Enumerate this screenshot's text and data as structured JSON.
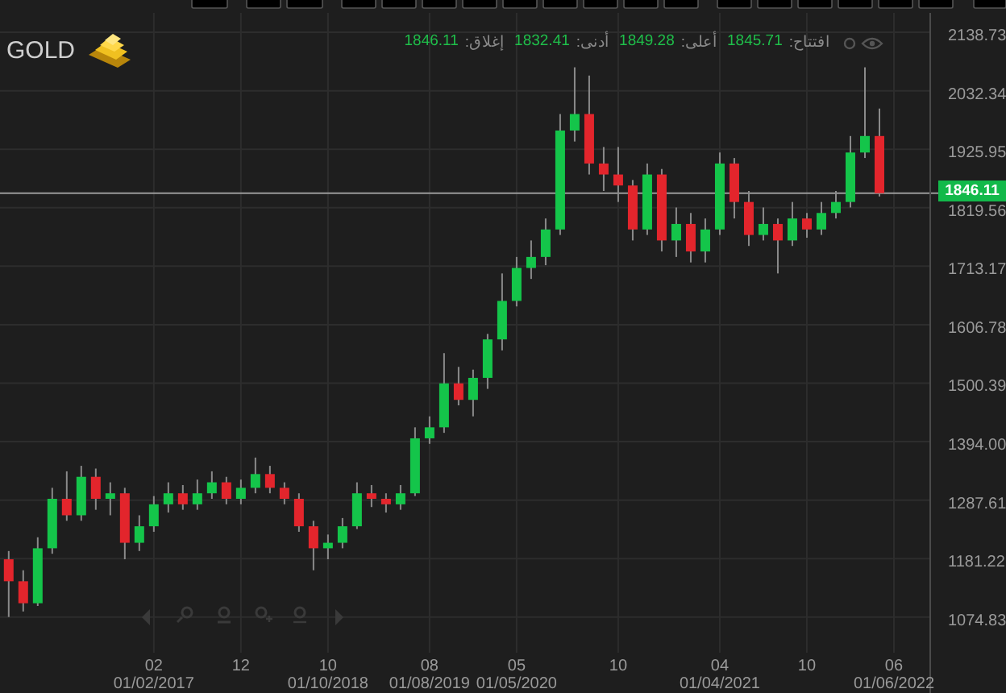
{
  "symbol": {
    "name": "GOLD"
  },
  "ohlc_header": [
    {
      "kind": "value",
      "text": "1846.11"
    },
    {
      "kind": "label",
      "text": "إغلاق:"
    },
    {
      "kind": "value",
      "text": "1832.41"
    },
    {
      "kind": "label",
      "text": "أدنى:"
    },
    {
      "kind": "value",
      "text": "1849.28"
    },
    {
      "kind": "label",
      "text": "أعلى:"
    },
    {
      "kind": "value",
      "text": "1845.71"
    },
    {
      "kind": "label",
      "text": "افتتاح:"
    }
  ],
  "chart": {
    "x_dates": [
      {
        "kind": "dated",
        "date": "01/02/2017"
      },
      {
        "kind": "plain"
      },
      {
        "kind": "dated",
        "date": "01/10/2018"
      },
      {
        "kind": "dated",
        "date": "01/08/2019"
      },
      {
        "kind": "dated",
        "date": "01/05/2020"
      },
      {
        "kind": "plain"
      },
      {
        "kind": "dated",
        "date": "01/04/2021"
      },
      {
        "kind": "plain"
      },
      {
        "kind": "dated",
        "date": "01/06/2022"
      }
    ],
    "chart_data": {
      "type": "candlestick",
      "ylim": [
        1010,
        2174
      ],
      "grid": true,
      "ref_lines": [
        {
          "axis": "y",
          "value": 1846.11,
          "label": "1846.11",
          "color": "#9a9a9a"
        }
      ],
      "categories": [
        null,
        null,
        null,
        null,
        null,
        null,
        null,
        null,
        null,
        null,
        "02",
        null,
        null,
        null,
        null,
        null,
        "12",
        null,
        null,
        null,
        null,
        null,
        "10",
        null,
        null,
        null,
        null,
        null,
        null,
        "08",
        null,
        null,
        null,
        null,
        null,
        "05",
        null,
        null,
        null,
        null,
        null,
        null,
        "10",
        null,
        null,
        null,
        null,
        null,
        null,
        "04",
        null,
        null,
        null,
        null,
        null,
        "10",
        null,
        null,
        null,
        null,
        null,
        "06"
      ],
      "yticks": [
        {
          "value": 1074.83,
          "label": "1074.83"
        },
        {
          "value": 1181.22,
          "label": "1181.22"
        },
        {
          "value": 1287.61,
          "label": "1287.61"
        },
        {
          "value": 1394.0,
          "label": "1394.00"
        },
        {
          "value": 1500.39,
          "label": "1500.39"
        },
        {
          "value": 1606.78,
          "label": "1606.78"
        },
        {
          "value": 1713.17,
          "label": "1713.17"
        },
        {
          "value": 1819.56,
          "label": "1819.56"
        },
        {
          "value": 1925.95,
          "label": "1925.95"
        },
        {
          "value": 2032.34,
          "label": "2032.34"
        },
        {
          "value": 2138.73,
          "label": "2138.73"
        }
      ],
      "ohlc": [
        [
          1180,
          1195,
          1075,
          1140
        ],
        [
          1140,
          1160,
          1085,
          1100
        ],
        [
          1100,
          1220,
          1095,
          1200
        ],
        [
          1200,
          1310,
          1190,
          1290
        ],
        [
          1290,
          1340,
          1250,
          1260
        ],
        [
          1260,
          1350,
          1250,
          1330
        ],
        [
          1330,
          1345,
          1270,
          1290
        ],
        [
          1290,
          1320,
          1260,
          1300
        ],
        [
          1300,
          1310,
          1180,
          1210
        ],
        [
          1210,
          1260,
          1195,
          1240
        ],
        [
          1240,
          1295,
          1230,
          1280
        ],
        [
          1280,
          1320,
          1265,
          1300
        ],
        [
          1300,
          1315,
          1270,
          1280
        ],
        [
          1280,
          1325,
          1270,
          1300
        ],
        [
          1300,
          1340,
          1290,
          1320
        ],
        [
          1320,
          1330,
          1280,
          1290
        ],
        [
          1290,
          1325,
          1280,
          1310
        ],
        [
          1310,
          1365,
          1300,
          1335
        ],
        [
          1335,
          1350,
          1300,
          1310
        ],
        [
          1310,
          1320,
          1280,
          1290
        ],
        [
          1290,
          1300,
          1230,
          1240
        ],
        [
          1240,
          1250,
          1160,
          1200
        ],
        [
          1200,
          1225,
          1180,
          1210
        ],
        [
          1210,
          1255,
          1200,
          1240
        ],
        [
          1240,
          1320,
          1235,
          1300
        ],
        [
          1300,
          1315,
          1275,
          1290
        ],
        [
          1290,
          1300,
          1265,
          1280
        ],
        [
          1280,
          1315,
          1270,
          1300
        ],
        [
          1300,
          1420,
          1295,
          1400
        ],
        [
          1400,
          1440,
          1390,
          1420
        ],
        [
          1420,
          1555,
          1410,
          1500
        ],
        [
          1500,
          1530,
          1460,
          1470
        ],
        [
          1470,
          1525,
          1440,
          1510
        ],
        [
          1510,
          1590,
          1490,
          1580
        ],
        [
          1580,
          1700,
          1560,
          1650
        ],
        [
          1650,
          1730,
          1640,
          1710
        ],
        [
          1710,
          1760,
          1690,
          1730
        ],
        [
          1730,
          1800,
          1715,
          1780
        ],
        [
          1780,
          1990,
          1770,
          1960
        ],
        [
          1960,
          2075,
          1940,
          1990
        ],
        [
          1990,
          2060,
          1880,
          1900
        ],
        [
          1900,
          1930,
          1850,
          1880
        ],
        [
          1880,
          1930,
          1830,
          1860
        ],
        [
          1860,
          1870,
          1760,
          1780
        ],
        [
          1780,
          1900,
          1770,
          1880
        ],
        [
          1880,
          1890,
          1740,
          1760
        ],
        [
          1760,
          1820,
          1730,
          1790
        ],
        [
          1790,
          1810,
          1720,
          1740
        ],
        [
          1740,
          1800,
          1720,
          1780
        ],
        [
          1780,
          1920,
          1770,
          1900
        ],
        [
          1900,
          1910,
          1800,
          1830
        ],
        [
          1830,
          1850,
          1750,
          1770
        ],
        [
          1770,
          1820,
          1760,
          1790
        ],
        [
          1790,
          1800,
          1700,
          1760
        ],
        [
          1760,
          1830,
          1750,
          1800
        ],
        [
          1800,
          1810,
          1765,
          1780
        ],
        [
          1780,
          1830,
          1770,
          1810
        ],
        [
          1810,
          1850,
          1800,
          1830
        ],
        [
          1830,
          1950,
          1820,
          1920
        ],
        [
          1920,
          2075,
          1910,
          1950
        ],
        [
          1950,
          2000,
          1840,
          1846
        ],
        null
      ]
    }
  }
}
